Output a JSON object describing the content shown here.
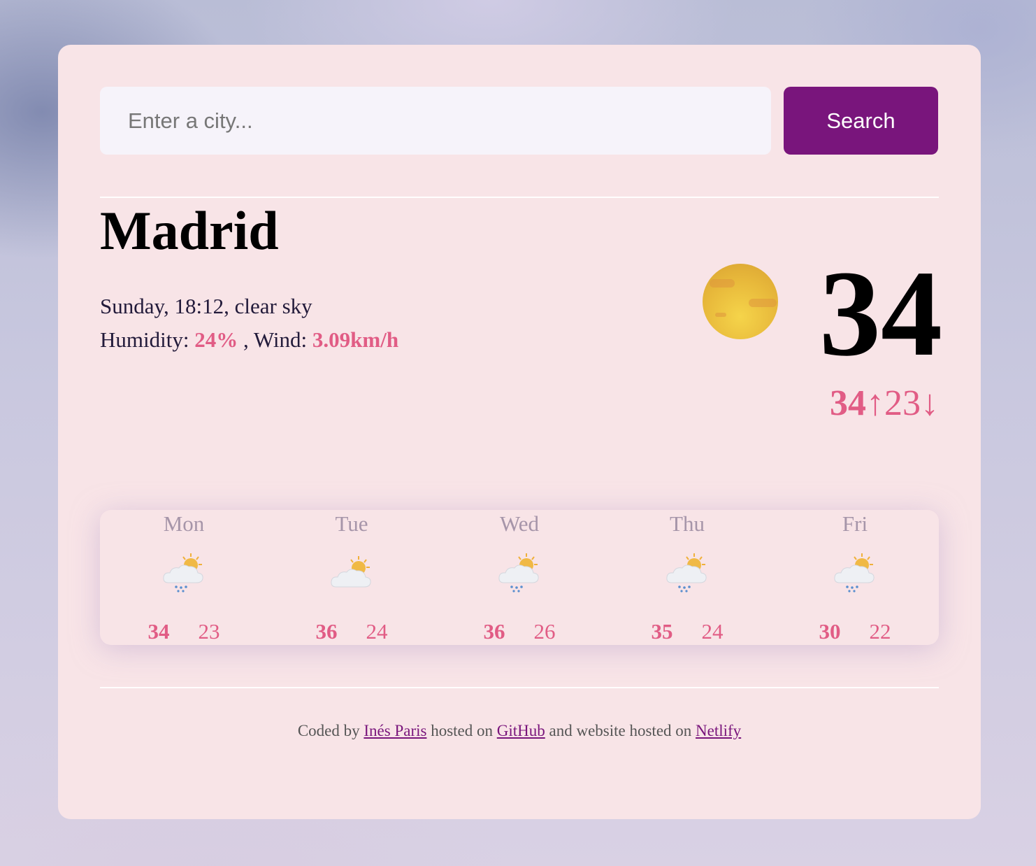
{
  "search": {
    "placeholder": "Enter a city...",
    "button_label": "Search"
  },
  "current": {
    "city": "Madrid",
    "datetime_desc": "Sunday, 18:12, clear sky",
    "humidity_label": "Humidity:",
    "humidity": "24%",
    "wind_label": ", Wind:",
    "wind": "3.09km/h",
    "temperature": "34",
    "icon": "sun-icon",
    "max": "34↑",
    "min": "23↓"
  },
  "forecast": [
    {
      "day": "Mon",
      "icon": "rain-cloud-sun-icon",
      "max": "34",
      "min": "23"
    },
    {
      "day": "Tue",
      "icon": "cloud-sun-icon",
      "max": "36",
      "min": "24"
    },
    {
      "day": "Wed",
      "icon": "rain-cloud-sun-icon",
      "max": "36",
      "min": "26"
    },
    {
      "day": "Thu",
      "icon": "rain-cloud-sun-icon",
      "max": "35",
      "min": "24"
    },
    {
      "day": "Fri",
      "icon": "rain-cloud-sun-icon",
      "max": "30",
      "min": "22"
    }
  ],
  "footer": {
    "text1": "Coded by",
    "author": "Inés Paris",
    "text2": "hosted on",
    "github": "GitHub",
    "text3": "and website hosted on",
    "netlify": "Netlify"
  },
  "colors": {
    "accent": "#e15c85",
    "button": "#79157c",
    "card": "#f8e4e7"
  }
}
